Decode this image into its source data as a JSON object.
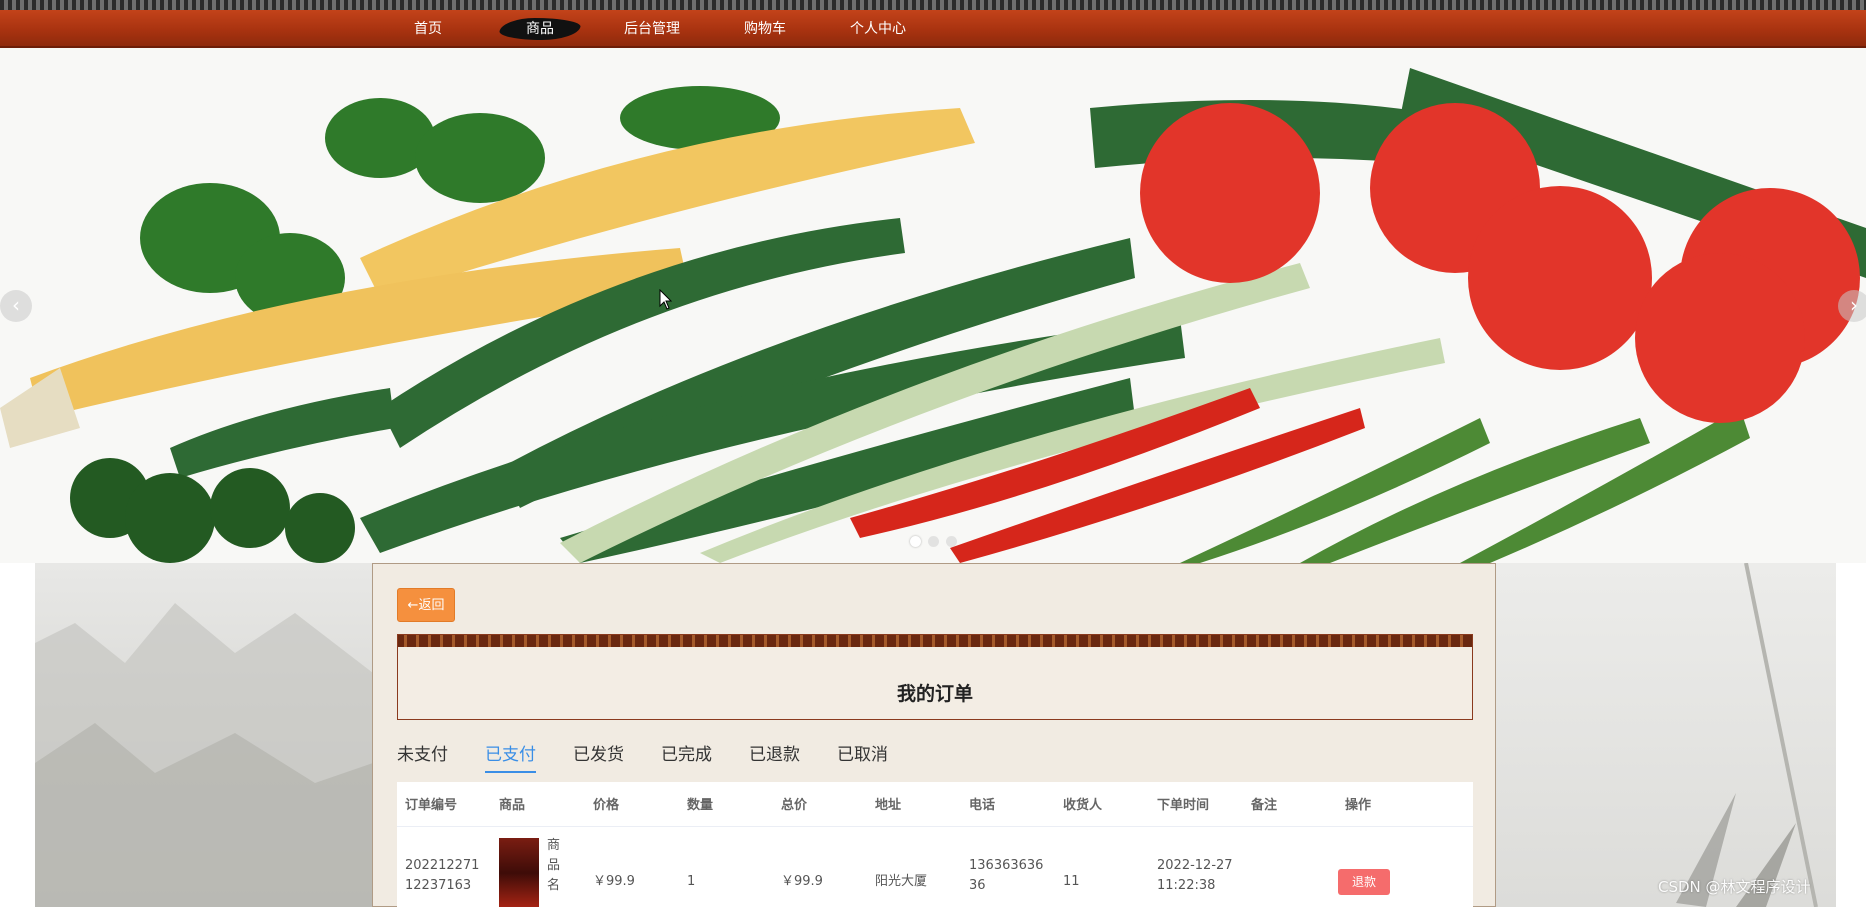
{
  "nav": {
    "items": [
      {
        "label": "首页"
      },
      {
        "label": "商品"
      },
      {
        "label": "后台管理"
      },
      {
        "label": "购物车"
      },
      {
        "label": "个人中心"
      }
    ],
    "active": "商品"
  },
  "banner": {
    "prev_arrow": "‹",
    "next_arrow": "›",
    "dots": 3,
    "active_dot": 1
  },
  "order_page": {
    "back_label": "←返回",
    "title": "我的订单",
    "tabs": [
      "未支付",
      "已支付",
      "已发货",
      "已完成",
      "已退款",
      "已取消"
    ],
    "active_tab": "已支付",
    "columns": [
      "订单编号",
      "商品",
      "价格",
      "数量",
      "总价",
      "地址",
      "电话",
      "收货人",
      "下单时间",
      "备注",
      "操作"
    ],
    "rows": [
      {
        "order_no_line1": "202212271",
        "order_no_line2": "12237163",
        "product_name": [
          "商",
          "品",
          "名"
        ],
        "price": "￥99.9",
        "quantity": "1",
        "total": "￥99.9",
        "address": "阳光大厦",
        "phone_line1": "136363636",
        "phone_line2": "36",
        "receiver": "11",
        "order_time_line1": "2022-12-27",
        "order_time_line2": "11:22:38",
        "remark": "",
        "action_label": "退款"
      }
    ]
  },
  "watermark": "CSDN @林文程序设计",
  "colors": {
    "nav_bg": "#a93310",
    "back_button": "#f5903e",
    "active_tab": "#3a8ee6",
    "refund_button": "#f56c6c",
    "panel_bg": "#f1ebe2"
  }
}
